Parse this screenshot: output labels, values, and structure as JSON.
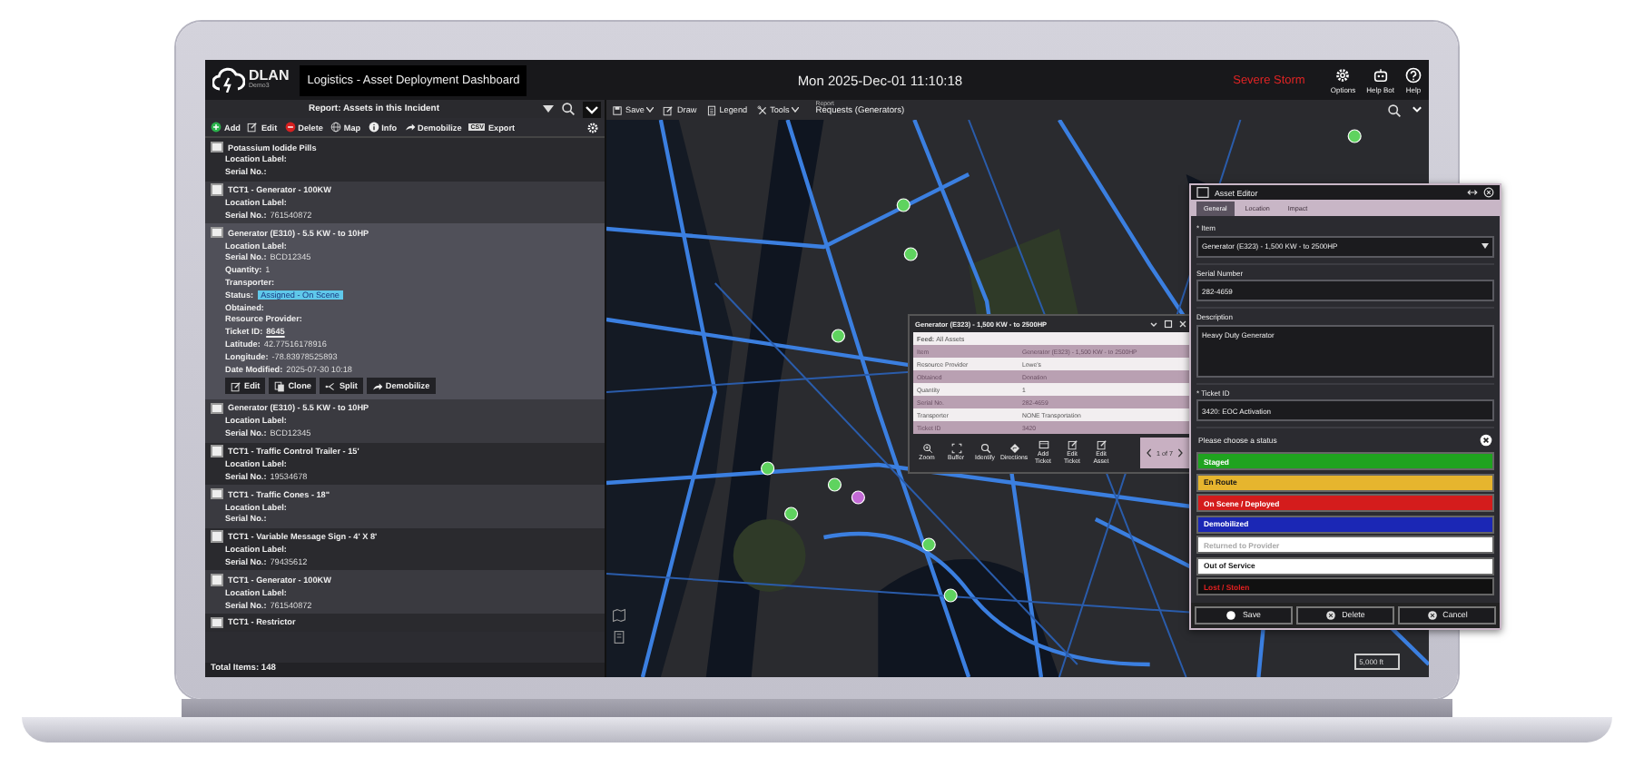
{
  "topbar": {
    "logo_text": "DLAN",
    "logo_subtext": "Demo3",
    "title": "Logistics - Asset Deployment Dashboard",
    "datetime": "Mon 2025-Dec-01 11:10:18",
    "alert": "Severe Storm",
    "actions": [
      {
        "label": "Options"
      },
      {
        "label": "Help Bot"
      },
      {
        "label": "Help"
      }
    ]
  },
  "left_panel": {
    "report_title": "Report: Assets in this Incident",
    "toolbar": [
      {
        "label": "Add"
      },
      {
        "label": "Edit"
      },
      {
        "label": "Delete"
      },
      {
        "label": "Map"
      },
      {
        "label": "Info"
      },
      {
        "label": "Demobilize"
      },
      {
        "label": "Export",
        "icon_text": "CSV"
      }
    ],
    "items": [
      {
        "title": "Potassium Iodide Pills",
        "checked": false,
        "expanded": false,
        "fields": [
          {
            "label": "Location Label:"
          },
          {
            "label": "Serial No.:"
          }
        ]
      },
      {
        "title": "TCT1 - Generator - 100KW",
        "checked": false,
        "expanded": false,
        "fields": [
          {
            "label": "Location Label:"
          },
          {
            "label": "Serial No.:",
            "value": "761540872"
          }
        ]
      },
      {
        "title": "Generator (E310) - 5.5 KW - to 10HP",
        "checked": false,
        "expanded": true,
        "fields": [
          {
            "label": "Location Label:"
          },
          {
            "label": "Serial No.:",
            "value": "BCD12345"
          },
          {
            "label": "Quantity:",
            "value": "1"
          },
          {
            "label": "Transporter:"
          },
          {
            "label": "Status:",
            "value": "Assigned - On Scene",
            "kind": "badge"
          },
          {
            "label": "Obtained:"
          },
          {
            "label": "Resource Provider:"
          },
          {
            "label": "Ticket ID:",
            "value": "8645",
            "kind": "link"
          },
          {
            "label": "Latitude:",
            "value": "42.77516178916"
          },
          {
            "label": "Longitude:",
            "value": "-78.83978525893"
          },
          {
            "label": "Date Modified:",
            "value": "2025-07-30 10:18"
          }
        ],
        "actions": [
          {
            "label": "Edit"
          },
          {
            "label": "Clone"
          },
          {
            "label": "Split"
          },
          {
            "label": "Demobilize"
          }
        ]
      },
      {
        "title": "Generator (E310) - 5.5 KW - to 10HP",
        "checked": false,
        "expanded": false,
        "fields": [
          {
            "label": "Location Label:"
          },
          {
            "label": "Serial No.:",
            "value": "BCD12345"
          }
        ]
      },
      {
        "title": "TCT1 - Traffic Control Trailer - 15'",
        "checked": false,
        "expanded": false,
        "fields": [
          {
            "label": "Location Label:"
          },
          {
            "label": "Serial No.:",
            "value": "19534678"
          }
        ]
      },
      {
        "title": "TCT1 - Traffic Cones - 18\"",
        "checked": false,
        "expanded": false,
        "fields": [
          {
            "label": "Location Label:"
          },
          {
            "label": "Serial No.:"
          }
        ]
      },
      {
        "title": "TCT1 - Variable Message Sign - 4' X 8'",
        "checked": false,
        "expanded": false,
        "fields": [
          {
            "label": "Location Label:"
          },
          {
            "label": "Serial No.:",
            "value": "79435612"
          }
        ]
      },
      {
        "title": "TCT1 - Generator - 100KW",
        "checked": false,
        "expanded": false,
        "fields": [
          {
            "label": "Location Label:"
          },
          {
            "label": "Serial No.:",
            "value": "761540872"
          }
        ]
      },
      {
        "title": "TCT1 - Restrictor",
        "checked": false,
        "expanded": false
      }
    ],
    "total": "Total Items: 148"
  },
  "map_toolbar": {
    "items": [
      {
        "label": "Save",
        "dropdown": true
      },
      {
        "label": "Draw",
        "dropdown": false
      },
      {
        "label": "Legend",
        "dropdown": false
      },
      {
        "label": "Tools",
        "dropdown": true
      }
    ],
    "report_label": "Report",
    "report_name": "Requests (Generators)"
  },
  "map": {
    "scale": "5,000 ft"
  },
  "popup": {
    "title": "Generator (E323) - 1,500 KW - to 2500HP",
    "feed_label": "Feed:",
    "feed_value": "All Assets",
    "rows": [
      {
        "label": "Item",
        "value": "Generator (E323) - 1,500 KW - to 2500HP"
      },
      {
        "label": "Resource Provider",
        "value": "Lowe's"
      },
      {
        "label": "Obtained",
        "value": "Donation"
      },
      {
        "label": "Quantity",
        "value": "1"
      },
      {
        "label": "Serial No.",
        "value": "282-4659"
      },
      {
        "label": "Transporter",
        "value": "NONE Transportation"
      },
      {
        "label": "Ticket ID",
        "value": "3420"
      }
    ],
    "actions": [
      {
        "label": "Zoom"
      },
      {
        "label": "Buffer"
      },
      {
        "label": "Identify"
      },
      {
        "label": "Directions"
      },
      {
        "label": "Add Ticket"
      },
      {
        "label": "Edit Ticket"
      },
      {
        "label": "Edit Asset"
      }
    ],
    "pager": "1 of 7"
  },
  "editor": {
    "title": "Asset Editor",
    "tabs": [
      {
        "label": "General",
        "selected": true
      },
      {
        "label": "Location",
        "selected": false
      },
      {
        "label": "Impact",
        "selected": false
      }
    ],
    "fields": [
      {
        "label": "* Item",
        "value": "Generator (E323) - 1,500 KW - to 2500HP",
        "kind": "select"
      },
      {
        "label": "Serial Number",
        "value": "282-4659",
        "kind": "text"
      },
      {
        "label": "Description",
        "value": "Heavy Duty Generator",
        "kind": "textarea"
      },
      {
        "label": "* Ticket ID",
        "value": "3420: EOC Activation",
        "kind": "text"
      }
    ],
    "status_prompt": "Please choose a status",
    "statuses": [
      {
        "label": "Staged",
        "color": "#1fa31f",
        "disabled": false
      },
      {
        "label": "En Route",
        "color": "#e6b52e",
        "disabled": false
      },
      {
        "label": "On Scene / Deployed",
        "color": "#d41c1c",
        "disabled": false
      },
      {
        "label": "Demobilized",
        "color": "#1b27b5",
        "disabled": false
      },
      {
        "label": "Returned to Provider",
        "color": "#ffffff",
        "disabled": true
      },
      {
        "label": "Out of Service",
        "color": "#ffffff",
        "disabled": false
      },
      {
        "label": "Lost / Stolen",
        "color": "#111111",
        "disabled": false
      }
    ],
    "buttons": [
      {
        "label": "Save"
      },
      {
        "label": "Delete"
      },
      {
        "label": "Cancel"
      }
    ]
  }
}
